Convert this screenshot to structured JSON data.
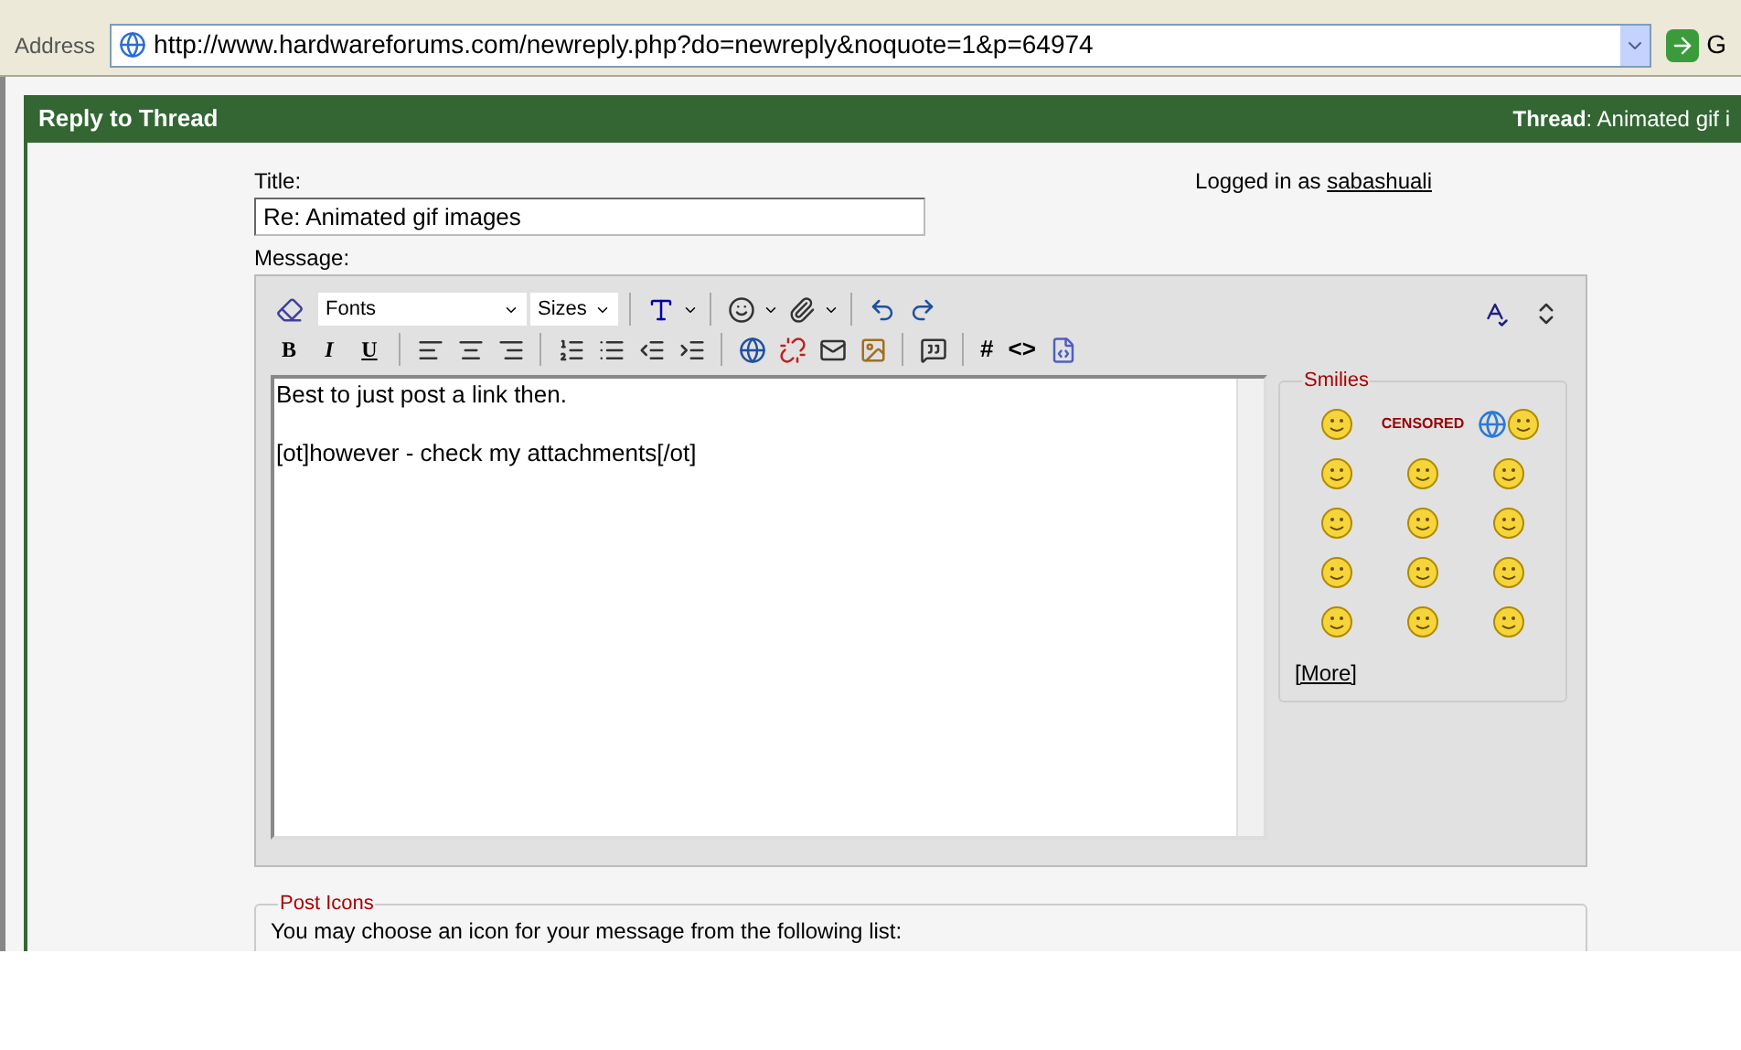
{
  "address_bar": {
    "label": "Address",
    "url": "http://www.hardwareforums.com/newreply.php?do=newreply&noquote=1&p=64974",
    "go": "G"
  },
  "header": {
    "title": "Reply to Thread",
    "thread_label": "Thread",
    "thread_title": ": Animated gif i"
  },
  "form": {
    "title_label": "Title:",
    "title_value": "Re: Animated gif images",
    "logged_in": "Logged in as",
    "username": "sabashuali",
    "message_label": "Message:"
  },
  "editor": {
    "font_select": "Fonts",
    "size_select": "Sizes",
    "format_buttons": [
      "B",
      "I",
      "U"
    ],
    "code_buttons": [
      "#",
      "<>"
    ],
    "message_paragraphs": [
      "Best to just post a link then.",
      "[ot]however - check my attachments[/ot]"
    ]
  },
  "smilies": {
    "title": "Smilies",
    "more": "[More]",
    "items": [
      {
        "kind": "face"
      },
      {
        "kind": "text",
        "label": "CENSORED"
      },
      {
        "kind": "pair"
      },
      {
        "kind": "face"
      },
      {
        "kind": "face"
      },
      {
        "kind": "face"
      },
      {
        "kind": "face"
      },
      {
        "kind": "face"
      },
      {
        "kind": "face"
      },
      {
        "kind": "face"
      },
      {
        "kind": "face"
      },
      {
        "kind": "face"
      },
      {
        "kind": "face"
      },
      {
        "kind": "face"
      },
      {
        "kind": "face"
      }
    ]
  },
  "post_icons": {
    "title": "Post Icons",
    "text": "You may choose an icon for your message from the following list:"
  }
}
